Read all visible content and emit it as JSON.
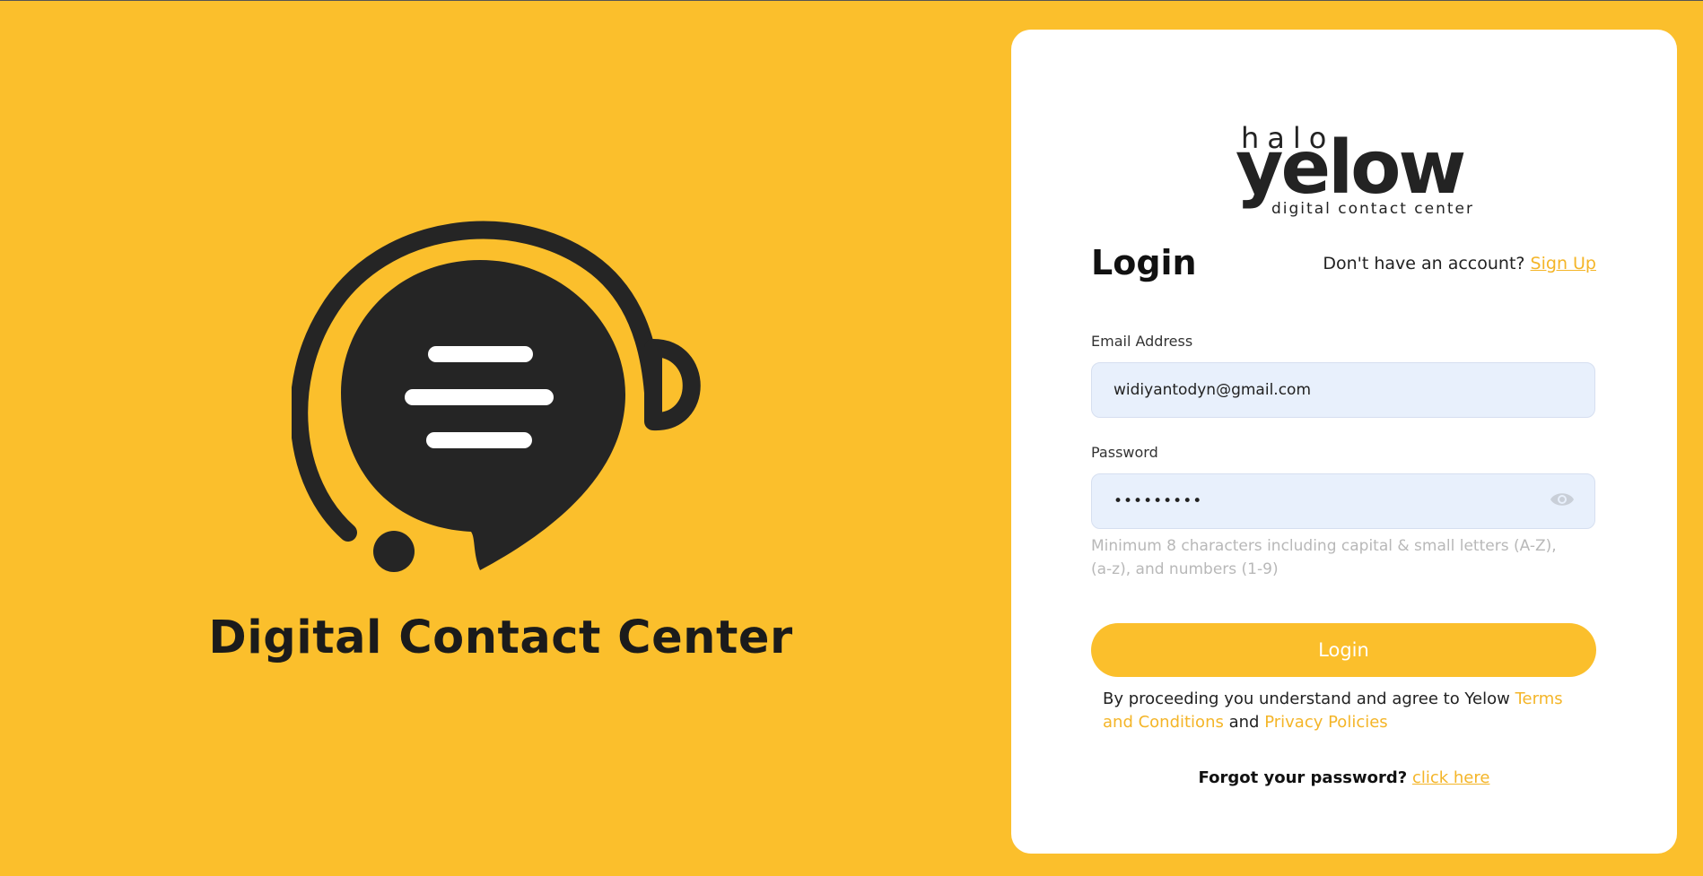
{
  "hero": {
    "title": "Digital Contact Center",
    "logo_icon": "headset-chat-bubble-icon"
  },
  "brand": {
    "halo": "halo",
    "yelow": "yelow",
    "tagline": "digital contact center"
  },
  "login": {
    "heading": "Login",
    "no_account_text": "Don't have an account?",
    "signup_link": "Sign Up",
    "email_label": "Email Address",
    "email_value": "widiyantodyn@gmail.com",
    "password_label": "Password",
    "password_value": "•••••••••",
    "password_hint": "Minimum 8 characters including capital & small letters (A-Z), (a-z), and numbers (1-9)",
    "submit_label": "Login",
    "agree_prefix": "By proceeding you understand and agree to Yelow",
    "terms_link": "Terms and Conditions",
    "agree_and": "and",
    "privacy_link": "Privacy Policies",
    "forgot_text": "Forgot your password?",
    "forgot_link": "click here"
  },
  "colors": {
    "background": "#FBBF2C",
    "accent": "#F4B528",
    "card": "#FFFFFF",
    "input_bg": "#E8F0FC",
    "dark": "#232323"
  }
}
